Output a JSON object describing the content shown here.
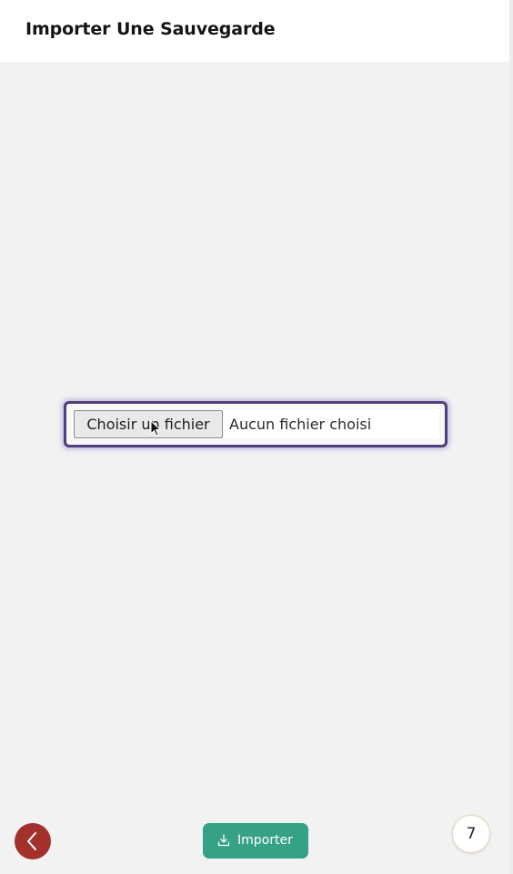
{
  "header": {
    "title": "Importer Une Sauvegarde"
  },
  "file_input": {
    "button_label": "Choisir un fichier",
    "status_text": "Aucun fichier choisi"
  },
  "footer": {
    "back_icon": "chevron-left-icon",
    "import_label": "Importer",
    "import_icon": "download-icon",
    "counter_value": "7"
  },
  "colors": {
    "back_button": "#a3302b",
    "import_button": "#35a287",
    "focus_border": "#4f3f7d"
  }
}
